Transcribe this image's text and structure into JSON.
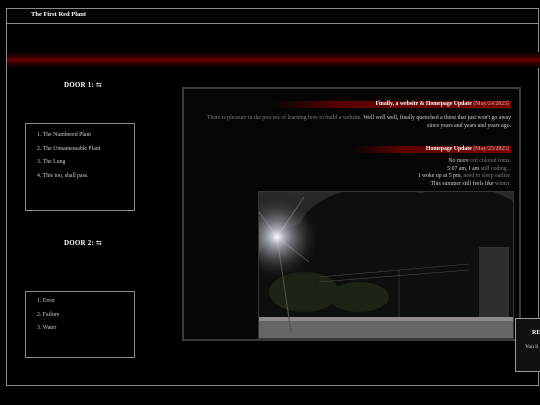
{
  "header": {
    "site_title": "The First Red Plant"
  },
  "sidebar": {
    "door1": {
      "title": "DOOR 1: ⇆",
      "items": [
        "1. The Numbered Plant",
        "2. The Unnamessable Plant",
        "3. The Lung",
        "4. This too, shall pass."
      ]
    },
    "door2": {
      "title": "DOOR 2: ⇆",
      "items": [
        "1. Error",
        "2. Failure",
        "3. Water"
      ]
    }
  },
  "posts": [
    {
      "title": "Finally, a website & Homepage Update",
      "date": "[May/24/2025]",
      "muted_text": "There is pleasure in the process of learning how to build a website.",
      "body_rest": " Well well well, finally quenched a thirst that just won't go away",
      "body_line2": "since years and years and years ago."
    },
    {
      "title": "Homepage Update",
      "date": "[May/25/2025]",
      "lines": [
        {
          "a": "No more ",
          "m": "red colored fonts."
        },
        {
          "a": "5:07 am, I am ",
          "m": "still coding..."
        },
        {
          "a": "I woke up at 5 pm, ",
          "m": "need to sleep earlier."
        },
        {
          "a": "This summer still feels like ",
          "m": "winter."
        }
      ]
    }
  ],
  "popup": {
    "title": "RE",
    "body": "You li"
  },
  "colors": {
    "background": "#000000",
    "accent_red": "#7a0000",
    "border": "#8a8a8a"
  }
}
